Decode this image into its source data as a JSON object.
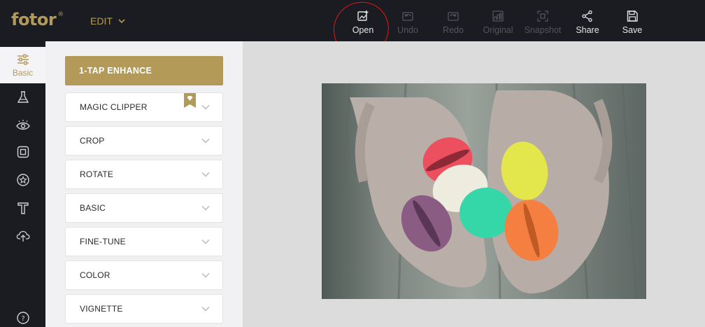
{
  "app": {
    "logo_text": "fotor",
    "logo_mark": "®",
    "brand_color": "#b49a59",
    "edit_menu_label": "EDIT"
  },
  "toolbar": {
    "items": [
      {
        "label": "Open",
        "icon": "open-image-icon",
        "enabled": true
      },
      {
        "label": "Undo",
        "icon": "undo-icon",
        "enabled": false
      },
      {
        "label": "Redo",
        "icon": "redo-icon",
        "enabled": false
      },
      {
        "label": "Original",
        "icon": "original-icon",
        "enabled": false
      },
      {
        "label": "Snapshot",
        "icon": "snapshot-icon",
        "enabled": false
      },
      {
        "label": "Share",
        "icon": "share-icon",
        "enabled": true
      },
      {
        "label": "Save",
        "icon": "save-icon",
        "enabled": true
      }
    ]
  },
  "annotation": {
    "shape": "hand-drawn circle around Open",
    "color": "#e01a1a"
  },
  "rail": {
    "items": [
      {
        "label": "Basic",
        "icon": "sliders-icon",
        "active": true
      },
      {
        "label": "",
        "icon": "flask-icon",
        "active": false
      },
      {
        "label": "",
        "icon": "eye-icon",
        "active": false
      },
      {
        "label": "",
        "icon": "frame-icon",
        "active": false
      },
      {
        "label": "",
        "icon": "sticker-star-icon",
        "active": false
      },
      {
        "label": "",
        "icon": "text-icon",
        "active": false
      },
      {
        "label": "",
        "icon": "cloud-upload-icon",
        "active": false
      },
      {
        "label": "?",
        "icon": "help-icon",
        "active": false
      }
    ]
  },
  "panel": {
    "enhance_label": "1-TAP ENHANCE",
    "sections": [
      {
        "label": "MAGIC CLIPPER",
        "premium": true
      },
      {
        "label": "CROP",
        "premium": false
      },
      {
        "label": "ROTATE",
        "premium": false
      },
      {
        "label": "BASIC",
        "premium": false
      },
      {
        "label": "FINE-TUNE",
        "premium": false
      },
      {
        "label": "COLOR",
        "premium": false
      },
      {
        "label": "VIGNETTE",
        "premium": false
      }
    ]
  }
}
